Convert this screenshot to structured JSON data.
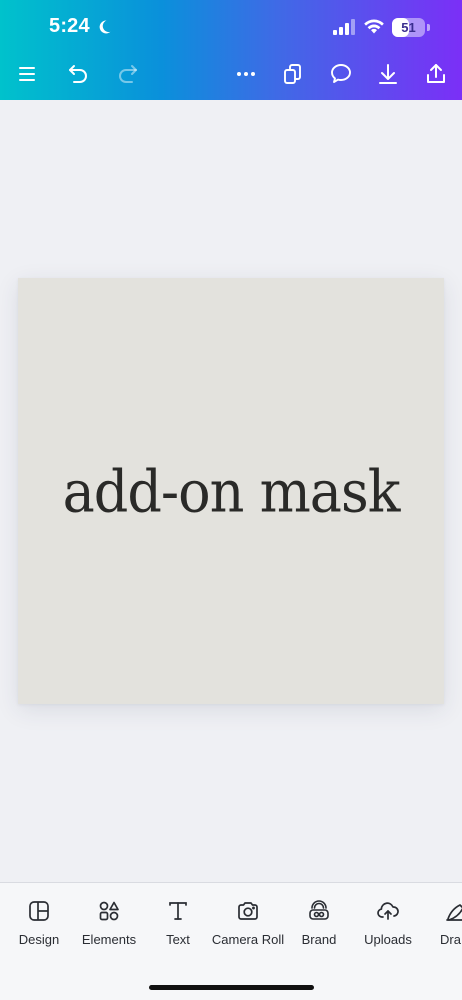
{
  "status_bar": {
    "time": "5:24",
    "battery_level": "51",
    "icons": [
      "moon-icon",
      "cellular-signal-icon",
      "wifi-icon",
      "battery-icon"
    ]
  },
  "toolbar": {
    "icons": [
      "menu-icon",
      "undo-icon",
      "redo-icon",
      "more-icon",
      "pages-icon",
      "comment-icon",
      "download-icon",
      "share-icon"
    ]
  },
  "canvas": {
    "text": "add-on mask",
    "background_color": "#e3e2dd",
    "text_color": "#2a2a28"
  },
  "bottom_nav": {
    "items": [
      {
        "label": "Design",
        "icon": "design-icon"
      },
      {
        "label": "Elements",
        "icon": "elements-icon"
      },
      {
        "label": "Text",
        "icon": "text-icon"
      },
      {
        "label": "Camera Roll",
        "icon": "camera-icon"
      },
      {
        "label": "Brand",
        "icon": "brand-icon"
      },
      {
        "label": "Uploads",
        "icon": "uploads-icon"
      },
      {
        "label": "Dra",
        "icon": "draw-icon"
      }
    ]
  },
  "colors": {
    "header_gradient_start": "#00c2cc",
    "header_gradient_end": "#7b2ff7",
    "workspace_bg": "#eff0f4"
  }
}
